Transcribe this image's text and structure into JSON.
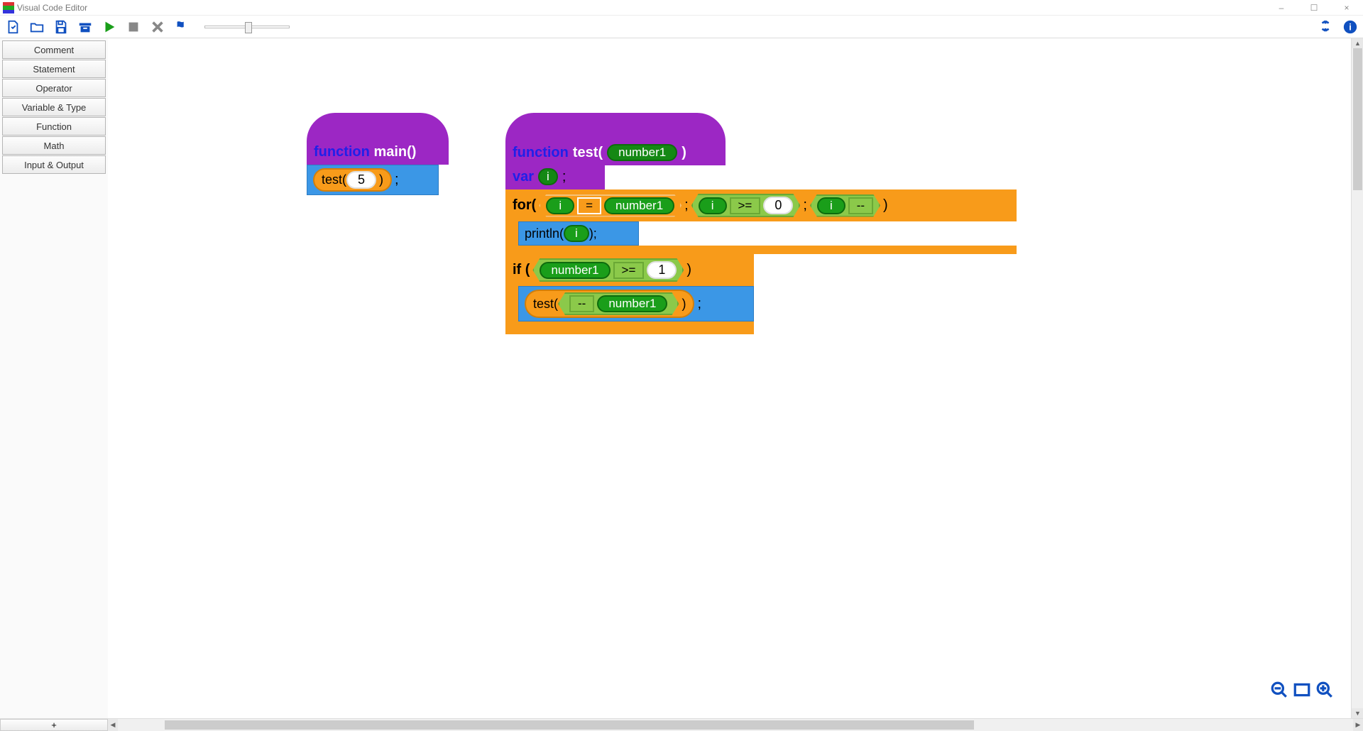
{
  "window": {
    "title": "Visual Code Editor",
    "minimize": "–",
    "maximize": "☐",
    "close": "×"
  },
  "sidebar": {
    "items": [
      {
        "label": "Comment"
      },
      {
        "label": "Statement"
      },
      {
        "label": "Operator"
      },
      {
        "label": "Variable & Type"
      },
      {
        "label": "Function"
      },
      {
        "label": "Math"
      },
      {
        "label": "Input & Output"
      }
    ]
  },
  "bottom": {
    "add": "+"
  },
  "blocks": {
    "main": {
      "kw": "function",
      "name": "main()",
      "call": {
        "fn": "test(",
        "arg": "5",
        "close": ")",
        "semi": ";"
      }
    },
    "test": {
      "kw": "function",
      "name": "test(",
      "param": "number1",
      "close": ")",
      "var_kw": "var",
      "var_name": "i",
      "var_semi": ";",
      "for_kw": "for(",
      "for_init_var": "i",
      "for_init_op": "=",
      "for_init_rhs": "number1",
      "for_cond_var": "i",
      "for_cond_op": ">=",
      "for_cond_val": "0",
      "for_step_var": "i",
      "for_step_op": "--",
      "for_close": ")",
      "println": "println(",
      "println_var": "i",
      "println_close": ");",
      "if_kw": "if (",
      "if_lhs": "number1",
      "if_op": ">=",
      "if_rhs": "1",
      "if_close": ")",
      "recurse_fn": "test(",
      "recurse_op": "--",
      "recurse_var": "number1",
      "recurse_close": ")",
      "recurse_semi": ";"
    }
  }
}
